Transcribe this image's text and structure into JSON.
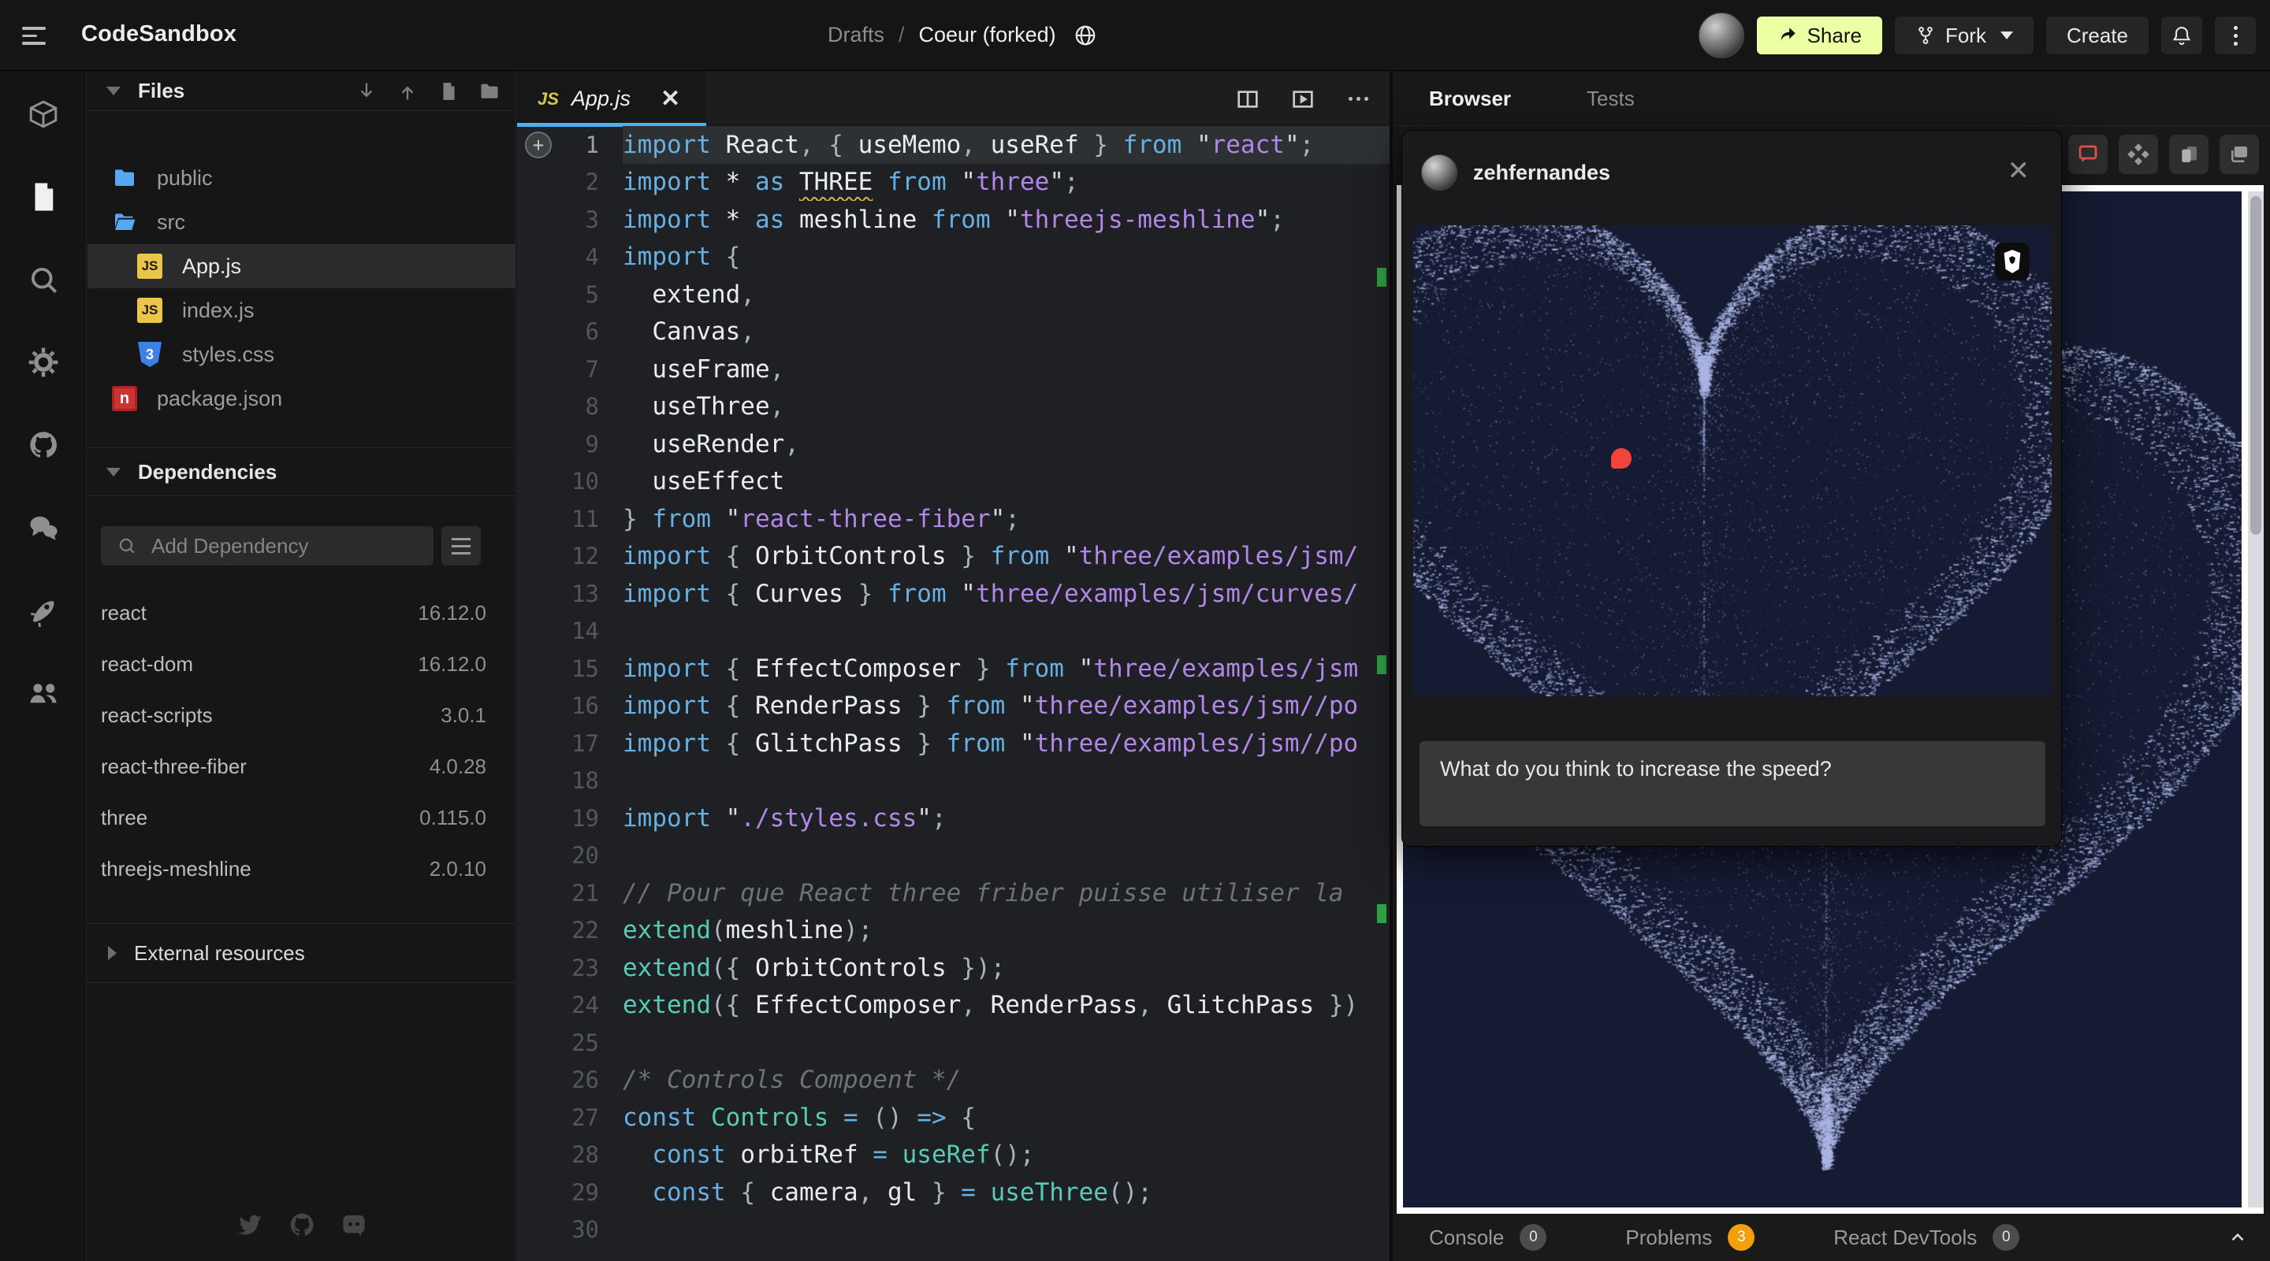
{
  "header": {
    "app_title": "CodeSandbox",
    "breadcrumb": {
      "parent": "Drafts",
      "separator": "/",
      "current": "Coeur (forked)"
    },
    "buttons": {
      "share": "Share",
      "fork": "Fork",
      "create": "Create"
    }
  },
  "left_rail": {
    "items": [
      "sandbox-cube",
      "file-explorer",
      "search",
      "settings",
      "github",
      "comments",
      "deployment",
      "live-collaboration"
    ]
  },
  "sidebar": {
    "files": {
      "title": "Files",
      "items": [
        {
          "name": "public",
          "type": "folder",
          "indent": 0,
          "selected": false
        },
        {
          "name": "src",
          "type": "folder-open",
          "indent": 0,
          "selected": false
        },
        {
          "name": "App.js",
          "type": "js",
          "indent": 1,
          "selected": true
        },
        {
          "name": "index.js",
          "type": "js",
          "indent": 1,
          "selected": false
        },
        {
          "name": "styles.css",
          "type": "css",
          "indent": 1,
          "selected": false
        },
        {
          "name": "package.json",
          "type": "npm",
          "indent": 0,
          "selected": false
        }
      ]
    },
    "dependencies": {
      "title": "Dependencies",
      "search_placeholder": "Add Dependency",
      "items": [
        {
          "name": "react",
          "version": "16.12.0"
        },
        {
          "name": "react-dom",
          "version": "16.12.0"
        },
        {
          "name": "react-scripts",
          "version": "3.0.1"
        },
        {
          "name": "react-three-fiber",
          "version": "4.0.28"
        },
        {
          "name": "three",
          "version": "0.115.0"
        },
        {
          "name": "threejs-meshline",
          "version": "2.0.10"
        }
      ]
    },
    "external_resources": {
      "title": "External resources"
    }
  },
  "editor": {
    "tab": {
      "icon": "JS",
      "label": "App.js",
      "close": "✕"
    },
    "lines": [
      {
        "n": 1,
        "sel": true,
        "marker": true,
        "t": [
          [
            "k",
            "import "
          ],
          [
            "i",
            "React"
          ],
          [
            "p",
            ", { "
          ],
          [
            "i",
            "useMemo"
          ],
          [
            "p",
            ", "
          ],
          [
            "i",
            "useRef"
          ],
          [
            "p",
            " } "
          ],
          [
            "k",
            "from "
          ],
          [
            "q",
            "\""
          ],
          [
            "s",
            "react"
          ],
          [
            "q",
            "\""
          ],
          [
            "p",
            ";"
          ]
        ]
      },
      {
        "n": 2,
        "t": [
          [
            "k",
            "import "
          ],
          [
            "i",
            "* "
          ],
          [
            "k",
            "as "
          ],
          [
            "w",
            "THREE"
          ],
          [
            "i",
            " "
          ],
          [
            "k",
            "from "
          ],
          [
            "q",
            "\""
          ],
          [
            "s",
            "three"
          ],
          [
            "q",
            "\""
          ],
          [
            "p",
            ";"
          ]
        ]
      },
      {
        "n": 3,
        "t": [
          [
            "k",
            "import "
          ],
          [
            "i",
            "* "
          ],
          [
            "k",
            "as "
          ],
          [
            "i",
            "meshline "
          ],
          [
            "k",
            "from "
          ],
          [
            "q",
            "\""
          ],
          [
            "s",
            "threejs-meshline"
          ],
          [
            "q",
            "\""
          ],
          [
            "p",
            ";"
          ]
        ]
      },
      {
        "n": 4,
        "t": [
          [
            "k",
            "import "
          ],
          [
            "p",
            "{"
          ]
        ]
      },
      {
        "n": 5,
        "t": [
          [
            "i",
            "  extend"
          ],
          [
            "p",
            ","
          ]
        ]
      },
      {
        "n": 6,
        "t": [
          [
            "i",
            "  Canvas"
          ],
          [
            "p",
            ","
          ]
        ]
      },
      {
        "n": 7,
        "t": [
          [
            "i",
            "  useFrame"
          ],
          [
            "p",
            ","
          ]
        ]
      },
      {
        "n": 8,
        "t": [
          [
            "i",
            "  useThree"
          ],
          [
            "p",
            ","
          ]
        ]
      },
      {
        "n": 9,
        "t": [
          [
            "i",
            "  useRender"
          ],
          [
            "p",
            ","
          ]
        ]
      },
      {
        "n": 10,
        "t": [
          [
            "i",
            "  useEffect"
          ]
        ]
      },
      {
        "n": 11,
        "t": [
          [
            "p",
            "} "
          ],
          [
            "k",
            "from "
          ],
          [
            "q",
            "\""
          ],
          [
            "s",
            "react-three-fiber"
          ],
          [
            "q",
            "\""
          ],
          [
            "p",
            ";"
          ]
        ]
      },
      {
        "n": 12,
        "t": [
          [
            "k",
            "import "
          ],
          [
            "p",
            "{ "
          ],
          [
            "i",
            "OrbitControls"
          ],
          [
            "p",
            " } "
          ],
          [
            "k",
            "from "
          ],
          [
            "q",
            "\""
          ],
          [
            "s",
            "three/examples/jsm/"
          ]
        ]
      },
      {
        "n": 13,
        "t": [
          [
            "k",
            "import "
          ],
          [
            "p",
            "{ "
          ],
          [
            "i",
            "Curves"
          ],
          [
            "p",
            " } "
          ],
          [
            "k",
            "from "
          ],
          [
            "q",
            "\""
          ],
          [
            "s",
            "three/examples/jsm/curves/"
          ]
        ]
      },
      {
        "n": 14,
        "t": []
      },
      {
        "n": 15,
        "t": [
          [
            "k",
            "import "
          ],
          [
            "p",
            "{ "
          ],
          [
            "i",
            "EffectComposer"
          ],
          [
            "p",
            " } "
          ],
          [
            "k",
            "from "
          ],
          [
            "q",
            "\""
          ],
          [
            "s",
            "three/examples/jsm"
          ]
        ]
      },
      {
        "n": 16,
        "t": [
          [
            "k",
            "import "
          ],
          [
            "p",
            "{ "
          ],
          [
            "i",
            "RenderPass"
          ],
          [
            "p",
            " } "
          ],
          [
            "k",
            "from "
          ],
          [
            "q",
            "\""
          ],
          [
            "s",
            "three/examples/jsm//po"
          ]
        ]
      },
      {
        "n": 17,
        "t": [
          [
            "k",
            "import "
          ],
          [
            "p",
            "{ "
          ],
          [
            "i",
            "GlitchPass"
          ],
          [
            "p",
            " } "
          ],
          [
            "k",
            "from "
          ],
          [
            "q",
            "\""
          ],
          [
            "s",
            "three/examples/jsm//po"
          ]
        ]
      },
      {
        "n": 18,
        "t": []
      },
      {
        "n": 19,
        "t": [
          [
            "k",
            "import "
          ],
          [
            "q",
            "\""
          ],
          [
            "s",
            "./styles.css"
          ],
          [
            "q",
            "\""
          ],
          [
            "p",
            ";"
          ]
        ]
      },
      {
        "n": 20,
        "t": []
      },
      {
        "n": 21,
        "t": [
          [
            "c",
            "// Pour que React three friber puisse utiliser la"
          ]
        ]
      },
      {
        "n": 22,
        "t": [
          [
            "f",
            "extend"
          ],
          [
            "p",
            "("
          ],
          [
            "i",
            "meshline"
          ],
          [
            "p",
            ");"
          ]
        ]
      },
      {
        "n": 23,
        "t": [
          [
            "f",
            "extend"
          ],
          [
            "p",
            "({ "
          ],
          [
            "i",
            "OrbitControls"
          ],
          [
            "p",
            " });"
          ]
        ]
      },
      {
        "n": 24,
        "t": [
          [
            "f",
            "extend"
          ],
          [
            "p",
            "({ "
          ],
          [
            "i",
            "EffectComposer"
          ],
          [
            "p",
            ", "
          ],
          [
            "i",
            "RenderPass"
          ],
          [
            "p",
            ", "
          ],
          [
            "i",
            "GlitchPass"
          ],
          [
            "p",
            " })"
          ]
        ]
      },
      {
        "n": 25,
        "t": []
      },
      {
        "n": 26,
        "t": [
          [
            "c",
            "/* Controls Compoent */"
          ]
        ]
      },
      {
        "n": 27,
        "t": [
          [
            "k",
            "const "
          ],
          [
            "f",
            "Controls "
          ],
          [
            "k",
            "= "
          ],
          [
            "p",
            "() "
          ],
          [
            "k",
            "=> "
          ],
          [
            "p",
            "{"
          ]
        ]
      },
      {
        "n": 28,
        "t": [
          [
            "k",
            "  const "
          ],
          [
            "i",
            "orbitRef "
          ],
          [
            "k",
            "= "
          ],
          [
            "f",
            "useRef"
          ],
          [
            "p",
            "();"
          ]
        ]
      },
      {
        "n": 29,
        "t": [
          [
            "k",
            "  const "
          ],
          [
            "p",
            "{ "
          ],
          [
            "i",
            "camera"
          ],
          [
            "p",
            ", "
          ],
          [
            "i",
            "gl"
          ],
          [
            "p",
            " } "
          ],
          [
            "k",
            "= "
          ],
          [
            "f",
            "useThree"
          ],
          [
            "p",
            "();"
          ]
        ]
      },
      {
        "n": 30,
        "t": []
      }
    ]
  },
  "preview": {
    "tabs": [
      {
        "label": "Browser",
        "active": true
      },
      {
        "label": "Tests",
        "active": false
      }
    ],
    "popup": {
      "username": "zehfernandes",
      "comment": "What do you think to increase the speed?"
    },
    "status_bar": {
      "items": [
        {
          "label": "Console",
          "count": "0",
          "accent": false
        },
        {
          "label": "Problems",
          "count": "3",
          "accent": true
        },
        {
          "label": "React DevTools",
          "count": "0",
          "accent": false
        }
      ]
    },
    "canvas": {
      "bg": "#151b33",
      "particle_rgb": "172,182,228",
      "pin_color": "#f4433a"
    }
  },
  "colors": {
    "tab_underline": "#47b3f5",
    "share_button_bg": "#edffa5",
    "problems_badge": "#f59e0b",
    "comment_tool_icon": "#e2574c"
  }
}
